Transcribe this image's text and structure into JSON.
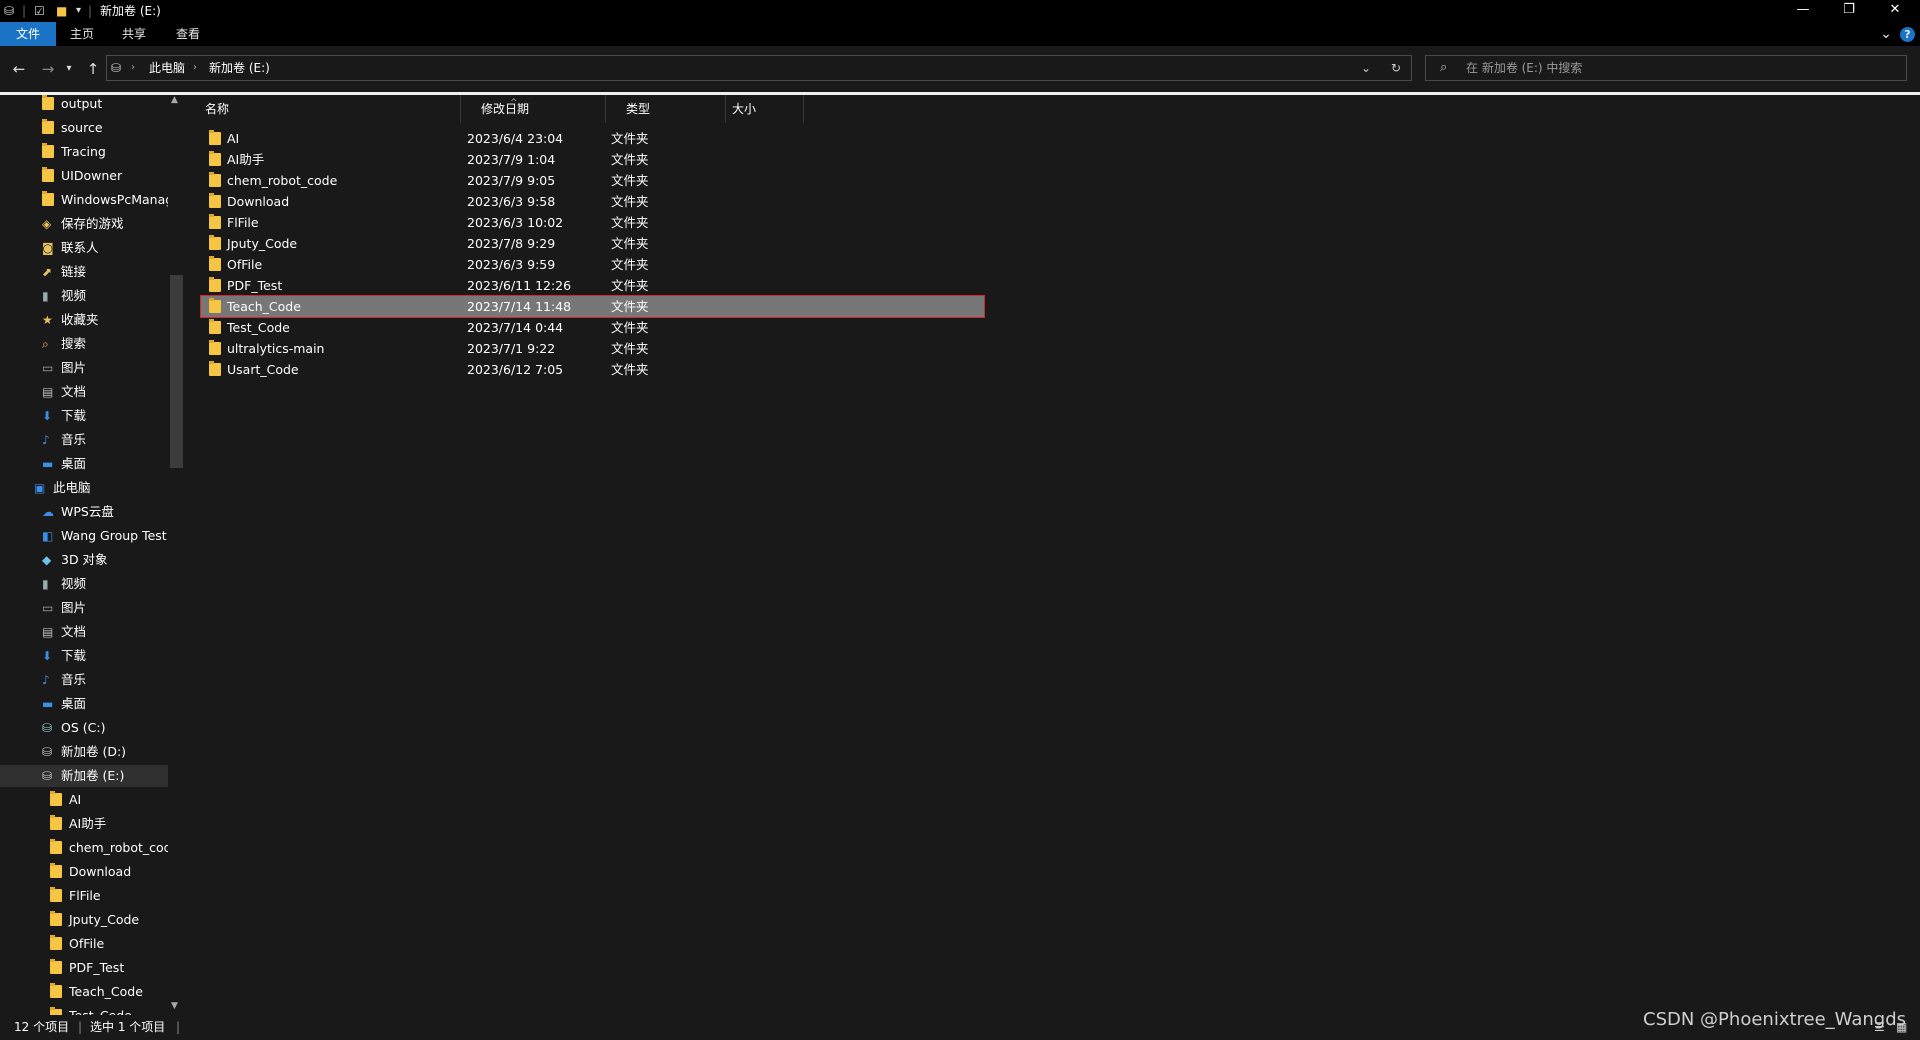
{
  "titlebar": {
    "title": "新加卷 (E:)",
    "buttons": {
      "minimize": "—",
      "restore": "❐",
      "close": "✕"
    }
  },
  "ribbon": {
    "tabs": [
      "文件",
      "主页",
      "共享",
      "查看"
    ],
    "active": "文件",
    "expand": "⌄",
    "help": "?"
  },
  "address": {
    "crumbs": [
      "此电脑",
      "新加卷 (E:)"
    ],
    "dropdown": "⌄",
    "refresh": "↻",
    "search_placeholder": "在 新加卷 (E:) 中搜索"
  },
  "nav": {
    "items": [
      {
        "label": "output",
        "icon": "folder-icon",
        "indent": 1
      },
      {
        "label": "source",
        "icon": "folder-icon",
        "indent": 1
      },
      {
        "label": "Tracing",
        "icon": "folder-icon",
        "indent": 1
      },
      {
        "label": "UIDowner",
        "icon": "folder-icon",
        "indent": 1
      },
      {
        "label": "WindowsPcManag",
        "icon": "folder-icon",
        "indent": 1
      },
      {
        "label": "保存的游戏",
        "icon": "saved-games-icon",
        "indent": 1
      },
      {
        "label": "联系人",
        "icon": "contacts-icon",
        "indent": 1
      },
      {
        "label": "链接",
        "icon": "links-icon",
        "indent": 1
      },
      {
        "label": "视频",
        "icon": "videos-icon",
        "indent": 1
      },
      {
        "label": "收藏夹",
        "icon": "favorites-icon",
        "indent": 1
      },
      {
        "label": "搜索",
        "icon": "searches-icon",
        "indent": 1
      },
      {
        "label": "图片",
        "icon": "pictures-icon",
        "indent": 1
      },
      {
        "label": "文档",
        "icon": "documents-icon",
        "indent": 1
      },
      {
        "label": "下载",
        "icon": "downloads-icon",
        "indent": 1
      },
      {
        "label": "音乐",
        "icon": "music-icon",
        "indent": 1
      },
      {
        "label": "桌面",
        "icon": "desktop-icon",
        "indent": 1
      },
      {
        "label": "此电脑",
        "icon": "this-pc-icon",
        "indent": 0
      },
      {
        "label": "WPS云盘",
        "icon": "cloud-icon",
        "indent": 1
      },
      {
        "label": "Wang Group Test",
        "icon": "group-icon",
        "indent": 1
      },
      {
        "label": "3D 对象",
        "icon": "3d-objects-icon",
        "indent": 1
      },
      {
        "label": "视频",
        "icon": "videos-icon",
        "indent": 1
      },
      {
        "label": "图片",
        "icon": "pictures-icon",
        "indent": 1
      },
      {
        "label": "文档",
        "icon": "documents-icon",
        "indent": 1
      },
      {
        "label": "下载",
        "icon": "downloads-icon",
        "indent": 1
      },
      {
        "label": "音乐",
        "icon": "music-icon",
        "indent": 1
      },
      {
        "label": "桌面",
        "icon": "desktop-icon",
        "indent": 1
      },
      {
        "label": "OS (C:)",
        "icon": "os-drive-icon",
        "indent": 1
      },
      {
        "label": "新加卷 (D:)",
        "icon": "drive-icon",
        "indent": 1
      },
      {
        "label": "新加卷 (E:)",
        "icon": "drive-icon",
        "indent": 1,
        "selected": true
      },
      {
        "label": "AI",
        "icon": "folder-icon",
        "indent": 2
      },
      {
        "label": "AI助手",
        "icon": "folder-icon",
        "indent": 2
      },
      {
        "label": "chem_robot_code",
        "icon": "folder-icon",
        "indent": 2
      },
      {
        "label": "Download",
        "icon": "folder-icon",
        "indent": 2
      },
      {
        "label": "FlFile",
        "icon": "folder-icon",
        "indent": 2
      },
      {
        "label": "Jputy_Code",
        "icon": "folder-icon",
        "indent": 2
      },
      {
        "label": "OfFile",
        "icon": "folder-icon",
        "indent": 2
      },
      {
        "label": "PDF_Test",
        "icon": "folder-icon",
        "indent": 2
      },
      {
        "label": "Teach_Code",
        "icon": "folder-icon",
        "indent": 2
      },
      {
        "label": "Test_Code",
        "icon": "folder-icon",
        "indent": 2
      }
    ]
  },
  "columns": [
    "名称",
    "修改日期",
    "类型",
    "大小"
  ],
  "files": [
    {
      "name": "AI",
      "date": "2023/6/4 23:04",
      "type": "文件夹"
    },
    {
      "name": "AI助手",
      "date": "2023/7/9 1:04",
      "type": "文件夹"
    },
    {
      "name": "chem_robot_code",
      "date": "2023/7/9 9:05",
      "type": "文件夹"
    },
    {
      "name": "Download",
      "date": "2023/6/3 9:58",
      "type": "文件夹"
    },
    {
      "name": "FlFile",
      "date": "2023/6/3 10:02",
      "type": "文件夹"
    },
    {
      "name": "Jputy_Code",
      "date": "2023/7/8 9:29",
      "type": "文件夹"
    },
    {
      "name": "OfFile",
      "date": "2023/6/3 9:59",
      "type": "文件夹"
    },
    {
      "name": "PDF_Test",
      "date": "2023/6/11 12:26",
      "type": "文件夹"
    },
    {
      "name": "Teach_Code",
      "date": "2023/7/14 11:48",
      "type": "文件夹",
      "selected": true
    },
    {
      "name": "Test_Code",
      "date": "2023/7/14 0:44",
      "type": "文件夹"
    },
    {
      "name": "ultralytics-main",
      "date": "2023/7/1 9:22",
      "type": "文件夹"
    },
    {
      "name": "Usart_Code",
      "date": "2023/6/12 7:05",
      "type": "文件夹"
    }
  ],
  "status": {
    "count": "12 个项目",
    "selected": "选中 1 个项目"
  },
  "watermark": "CSDN @Phoenixtree_Wangds",
  "colors": {
    "accent": "#1a73c4",
    "selection_outline": "#d9262e",
    "folder": "#f5c543"
  }
}
